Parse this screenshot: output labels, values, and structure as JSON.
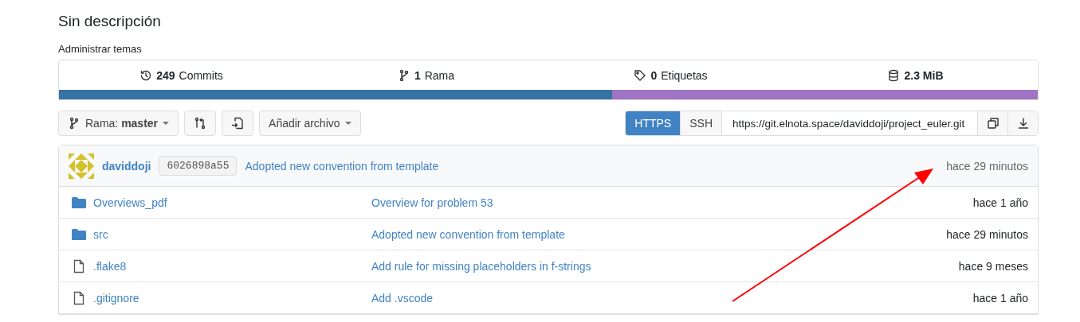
{
  "title": "Sin descripción",
  "topics_link": "Administrar temas",
  "stats": [
    {
      "kind": "commits",
      "count": "249",
      "label": "Commits"
    },
    {
      "kind": "branch",
      "count": "1",
      "label": "Rama"
    },
    {
      "kind": "tag",
      "count": "0",
      "label": "Etiquetas"
    },
    {
      "kind": "size",
      "count": "2.3 MiB"
    }
  ],
  "language_bar": [
    {
      "color": "#3572a5",
      "level": 0.565
    },
    {
      "color": "#a074c4",
      "level": 0.435
    }
  ],
  "toolbar": {
    "branch_label": "Rama:",
    "branch": "master",
    "add_file": "Añadir archivo",
    "clone_tabs": [
      {
        "label": "HTTPS",
        "selected": true
      },
      {
        "label": "SSH",
        "selected": false
      }
    ],
    "clone_url": "https://git.elnota.space/daviddoji/project_euler.git"
  },
  "latest_commit": {
    "author": "daviddoji",
    "sha": "6026898a55",
    "message": "Adopted new convention from template",
    "time": "hace 29 minutos"
  },
  "files": [
    {
      "kind": "folder",
      "name": "Overviews_pdf",
      "message": "Overview for problem 53",
      "time": "hace 1 año"
    },
    {
      "kind": "folder",
      "name": "src",
      "message": "Adopted new convention from template",
      "time": "hace 29 minutos"
    },
    {
      "kind": "file",
      "name": ".flake8",
      "message": "Add rule for missing placeholders in f-strings",
      "time": "hace 9 meses"
    },
    {
      "kind": "file",
      "name": ".gitignore",
      "message": "Add .vscode",
      "time": "hace 1 año"
    }
  ],
  "annotation_arrow": {
    "color": "#ff0000"
  }
}
